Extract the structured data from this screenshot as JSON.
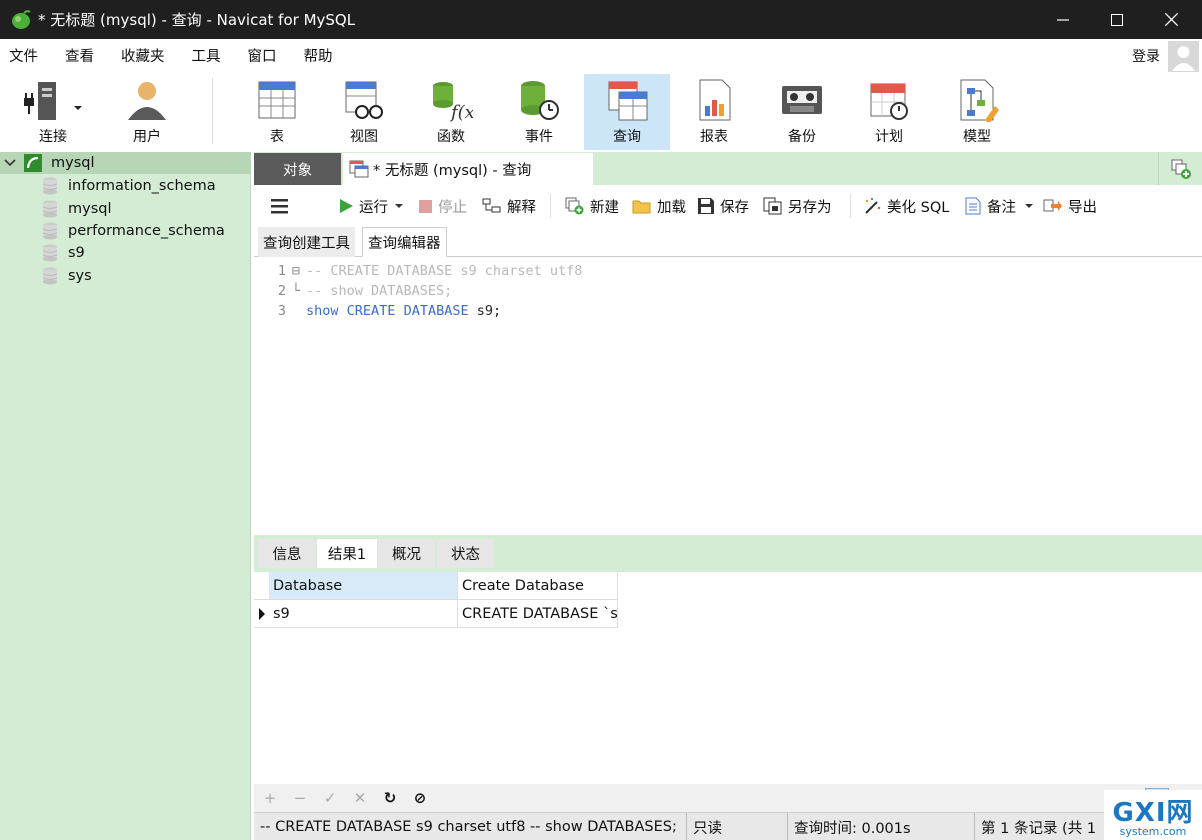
{
  "window": {
    "title": "* 无标题 (mysql) - 查询 - Navicat for MySQL",
    "minimize": "—",
    "maximize": "☐",
    "close": "✕"
  },
  "menu": [
    "文件",
    "查看",
    "收藏夹",
    "工具",
    "窗口",
    "帮助"
  ],
  "account": {
    "login_label": "登录"
  },
  "toolbar": {
    "connect": "连接",
    "user": "用户",
    "table": "表",
    "view": "视图",
    "function": "函数",
    "event": "事件",
    "query": "查询",
    "report": "报表",
    "backup": "备份",
    "schedule": "计划",
    "model": "模型"
  },
  "sidebar": {
    "connection": "mysql",
    "databases": [
      "information_schema",
      "mysql",
      "performance_schema",
      "s9",
      "sys"
    ]
  },
  "tabs": {
    "objects": "对象",
    "query_tab": "* 无标题 (mysql) - 查询"
  },
  "editor_toolbar": {
    "run": "运行",
    "stop": "停止",
    "explain": "解释",
    "new": "新建",
    "load": "加载",
    "save": "保存",
    "save_as": "另存为",
    "beautify": "美化 SQL",
    "comment": "备注",
    "export": "导出"
  },
  "subtabs": {
    "builder": "查询创建工具",
    "editor": "查询编辑器"
  },
  "code": {
    "lines": [
      {
        "num": "1",
        "fold": "⊟",
        "comment": "-- CREATE DATABASE s9 charset utf8"
      },
      {
        "num": "2",
        "fold": "└",
        "comment": "-- show DATABASES;"
      },
      {
        "num": "3",
        "kw1": "show",
        "kw2": "CREATE",
        "kw3": "DATABASE",
        "rest": "s9;"
      }
    ]
  },
  "result_tabs": [
    "信息",
    "结果1",
    "概况",
    "状态"
  ],
  "result_grid": {
    "columns": [
      "Database",
      "Create Database"
    ],
    "rows": [
      [
        "s9",
        "CREATE DATABASE `s"
      ]
    ]
  },
  "grid_toolbar": [
    "+",
    "−",
    "✓",
    "✕",
    "↻",
    "⊘"
  ],
  "status": {
    "sql": "-- CREATE DATABASE s9 charset utf8 -- show DATABASES;",
    "readonly": "只读",
    "query_time": "查询时间: 0.001s",
    "records": "第 1 条记录 (共 1"
  },
  "watermark": {
    "main": "GXI网",
    "sub": "system.com"
  },
  "colors": {
    "sidebar_bg": "#d3ecd3",
    "active_toolbar": "#cde6f7",
    "keyword": "#3b6bd0",
    "comment": "#b8b8b8"
  }
}
